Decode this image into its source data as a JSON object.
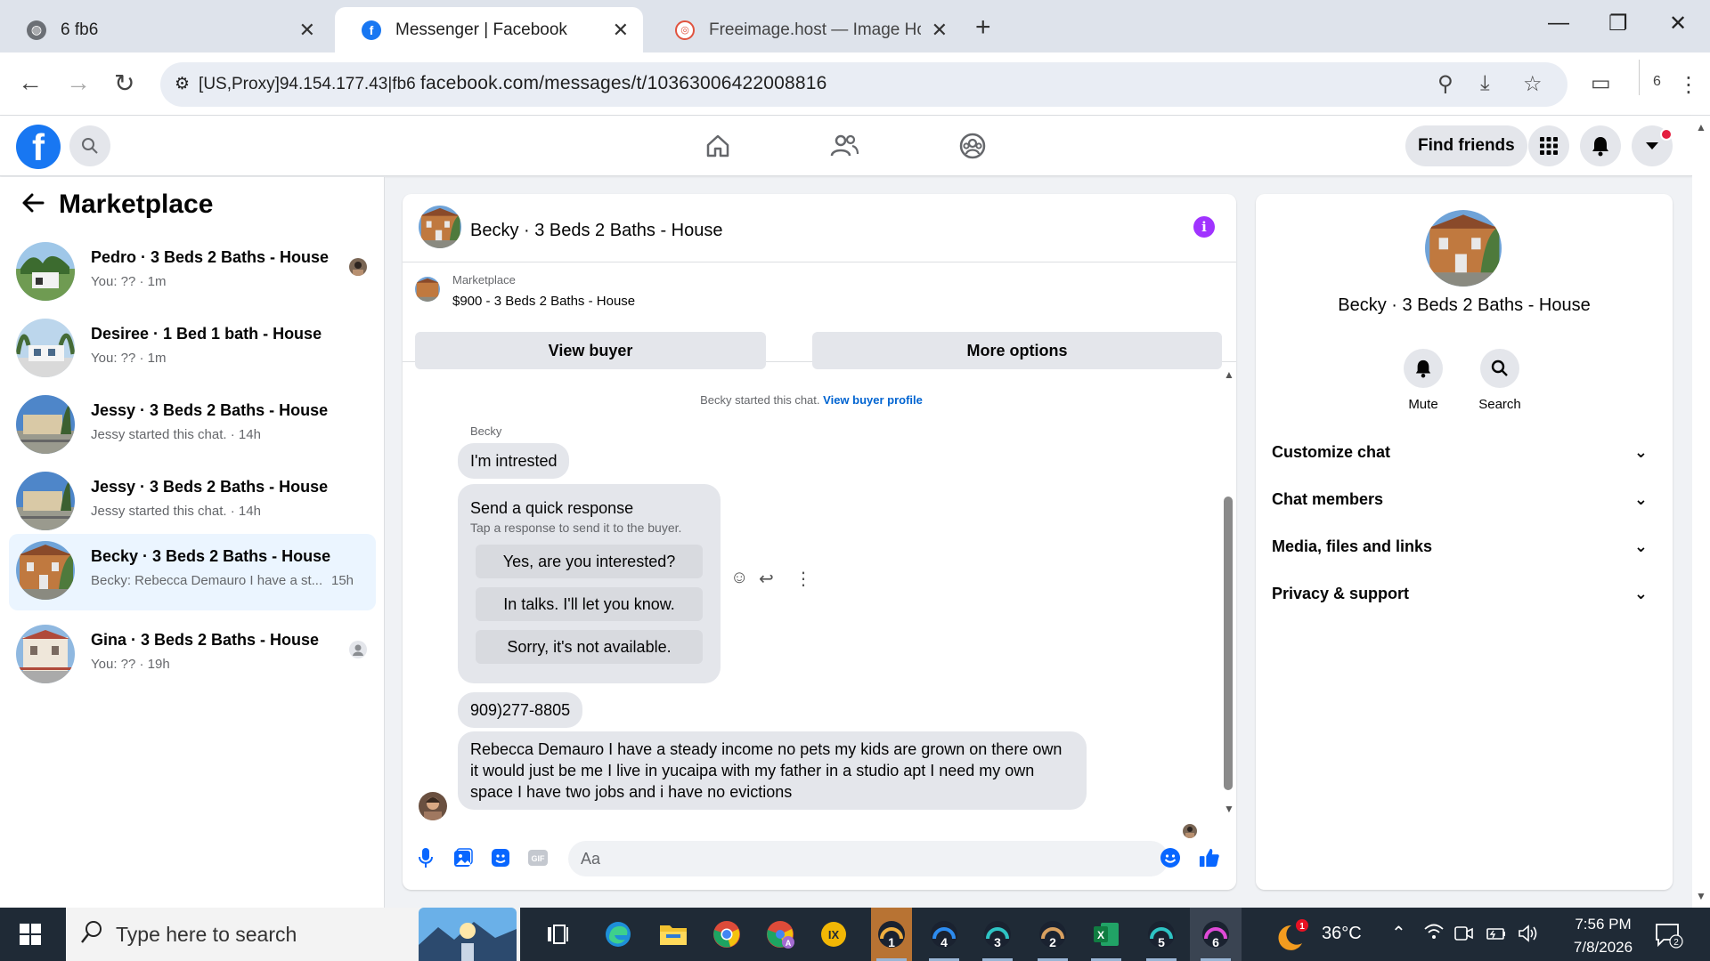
{
  "browser": {
    "tabs": [
      {
        "label": "6 fb6",
        "icon": "globe-icon"
      },
      {
        "label": "Messenger | Facebook",
        "icon": "facebook-icon"
      },
      {
        "label": "Freeimage.host — Image Hosti",
        "icon": "freeimage-icon"
      }
    ],
    "proxy_label": "[US,Proxy]94.154.177.43|fb6",
    "url": "facebook.com/messages/t/10363006422008816",
    "profile_count": "6"
  },
  "fb": {
    "find_friends": "Find friends"
  },
  "sidebar": {
    "title": "Marketplace",
    "chats": [
      {
        "title": "Pedro · 3 Beds 2 Baths - House",
        "subtitle": "You: ?? · 1m",
        "time": "",
        "selected": false,
        "status": "avatar"
      },
      {
        "title": "Desiree · 1 Bed 1 bath - House",
        "subtitle": "You: ?? · 1m",
        "time": "",
        "selected": false,
        "status": "none"
      },
      {
        "title": "Jessy · 3 Beds 2 Baths - House",
        "subtitle": "Jessy started this chat. · 14h",
        "time": "",
        "selected": false,
        "status": "none"
      },
      {
        "title": "Jessy · 3 Beds 2 Baths - House",
        "subtitle": "Jessy started this chat. · 14h",
        "time": "",
        "selected": false,
        "status": "none"
      },
      {
        "title": "Becky · 3 Beds 2 Baths - House",
        "subtitle": "Becky: Rebecca Demauro I have a st...",
        "time": "15h",
        "selected": true,
        "status": "none"
      },
      {
        "title": "Gina · 3 Beds 2 Baths - House",
        "subtitle": "You: ?? · 19h",
        "time": "",
        "selected": false,
        "status": "person"
      }
    ]
  },
  "chat": {
    "title": "Becky · 3 Beds 2 Baths - House",
    "listing": {
      "category": "Marketplace",
      "name": "$900 - 3 Beds 2 Baths - House",
      "view_buyer": "View buyer",
      "more_options": "More options"
    },
    "start_note": "Becky started this chat.",
    "start_link": "View buyer profile",
    "sender": "Becky",
    "msg1": "I'm intrested",
    "quick_response": {
      "title": "Send a quick response",
      "subtitle": "Tap a response to send it to the buyer.",
      "options": [
        "Yes, are you interested?",
        "In talks. I'll let you know.",
        "Sorry, it's not available."
      ]
    },
    "msg2": "909)277-8805",
    "msg3": "Rebecca Demauro I have a steady income no pets my kids are grown on there own it would just be me I live in yucaipa with my father in a studio apt I need my own space I have two jobs and i have no evictions",
    "composer_placeholder": "Aa"
  },
  "details": {
    "name": "Becky · 3 Beds 2 Baths - House",
    "mute": "Mute",
    "search": "Search",
    "sections": [
      "Customize chat",
      "Chat members",
      "Media, files and links",
      "Privacy & support"
    ]
  },
  "taskbar": {
    "search_placeholder": "Type here to search",
    "apps": [
      {
        "icon": "task-view-icon",
        "label": ""
      },
      {
        "icon": "edge-icon",
        "label": ""
      },
      {
        "icon": "file-explorer-icon",
        "label": ""
      },
      {
        "icon": "chrome-icon",
        "label": ""
      },
      {
        "icon": "chrome-profile-icon",
        "label": ""
      },
      {
        "icon": "ix-browser-icon",
        "label": ""
      },
      {
        "icon": "profile-browser-icon",
        "label": "1"
      },
      {
        "icon": "profile-browser-icon",
        "label": "4"
      },
      {
        "icon": "profile-browser-icon",
        "label": "3"
      },
      {
        "icon": "profile-browser-icon",
        "label": "2"
      },
      {
        "icon": "excel-icon",
        "label": ""
      },
      {
        "icon": "profile-browser-icon",
        "label": "5"
      },
      {
        "icon": "profile-browser-icon",
        "label": "6"
      }
    ],
    "weather_badge": "1",
    "temperature": "36°C",
    "time": "7:56 PM",
    "date": "7/8/2026",
    "notification_count": "2"
  },
  "colors": {
    "facebook_blue": "#1877f2",
    "messenger_blue": "#0866ff",
    "selected_chat": "#ebf5ff",
    "info_purple": "#a033ff",
    "taskbar": "#1f2a36"
  }
}
